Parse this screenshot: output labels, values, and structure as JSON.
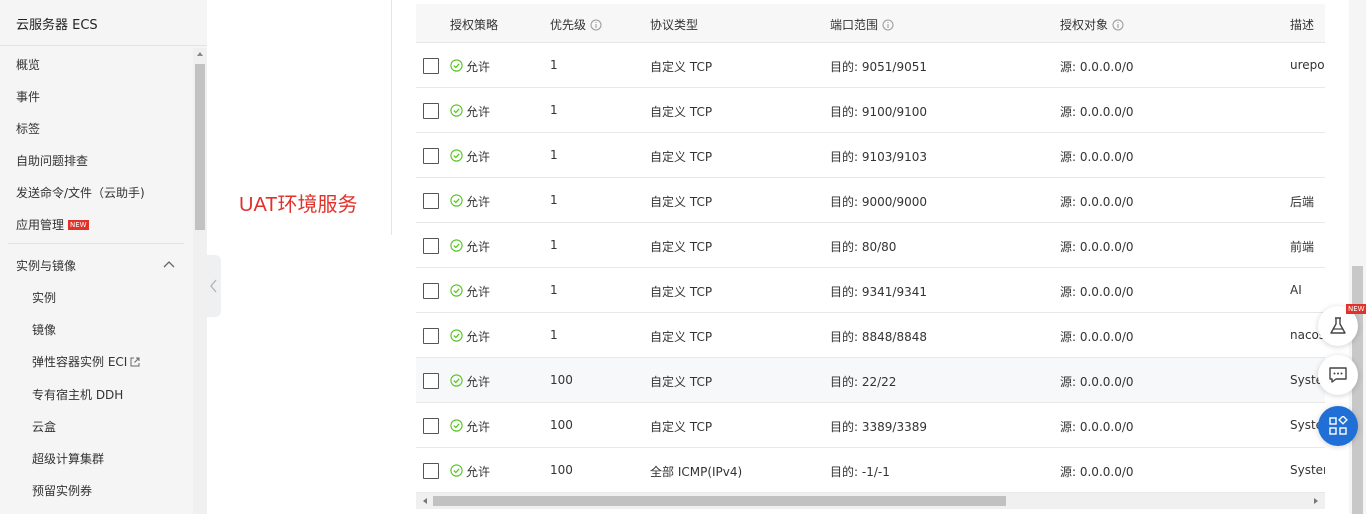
{
  "sidebar": {
    "title": "云服务器 ECS",
    "items": [
      "概览",
      "事件",
      "标签",
      "自助问题排查",
      "发送命令/文件（云助手)",
      "应用管理"
    ],
    "new_badge": "NEW",
    "group_title": "实例与镜像",
    "sub_items": [
      "实例",
      "镜像",
      "弹性容器实例 ECI",
      "专有宿主机 DDH",
      "云盒",
      "超级计算集群",
      "预留实例券"
    ]
  },
  "annotation": "UAT环境服务",
  "table": {
    "headers": [
      "授权策略",
      "优先级",
      "协议类型",
      "端口范围",
      "授权对象",
      "描述"
    ],
    "rows": [
      {
        "policy": "允许",
        "priority": "1",
        "protocol": "自定义 TCP",
        "port": "目的: 9051/9051",
        "source": "源: 0.0.0.0/0",
        "desc": "urepor"
      },
      {
        "policy": "允许",
        "priority": "1",
        "protocol": "自定义 TCP",
        "port": "目的: 9100/9100",
        "source": "源: 0.0.0.0/0",
        "desc": ""
      },
      {
        "policy": "允许",
        "priority": "1",
        "protocol": "自定义 TCP",
        "port": "目的: 9103/9103",
        "source": "源: 0.0.0.0/0",
        "desc": ""
      },
      {
        "policy": "允许",
        "priority": "1",
        "protocol": "自定义 TCP",
        "port": "目的: 9000/9000",
        "source": "源: 0.0.0.0/0",
        "desc": "后端"
      },
      {
        "policy": "允许",
        "priority": "1",
        "protocol": "自定义 TCP",
        "port": "目的: 80/80",
        "source": "源: 0.0.0.0/0",
        "desc": "前端"
      },
      {
        "policy": "允许",
        "priority": "1",
        "protocol": "自定义 TCP",
        "port": "目的: 9341/9341",
        "source": "源: 0.0.0.0/0",
        "desc": "AI"
      },
      {
        "policy": "允许",
        "priority": "1",
        "protocol": "自定义 TCP",
        "port": "目的: 8848/8848",
        "source": "源: 0.0.0.0/0",
        "desc": "nacos"
      },
      {
        "policy": "允许",
        "priority": "100",
        "protocol": "自定义 TCP",
        "port": "目的: 22/22",
        "source": "源: 0.0.0.0/0",
        "desc": "Syster"
      },
      {
        "policy": "允许",
        "priority": "100",
        "protocol": "自定义 TCP",
        "port": "目的: 3389/3389",
        "source": "源: 0.0.0.0/0",
        "desc": "Syste"
      },
      {
        "policy": "允许",
        "priority": "100",
        "protocol": "全部 ICMP(IPv4)",
        "port": "目的: -1/-1",
        "source": "源: 0.0.0.0/0",
        "desc": "System"
      }
    ]
  },
  "float_new_badge": "NEW",
  "colors": {
    "accent_red": "#e0312a",
    "allow_green": "#52c41a",
    "float_blue": "#1f6fd6"
  }
}
